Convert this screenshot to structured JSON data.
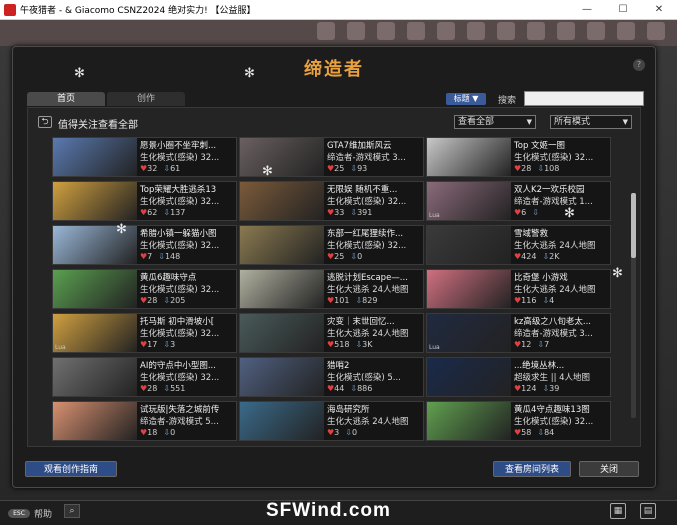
{
  "window": {
    "title": "午夜猎者 - & Giacomo CSNZ2024 绝对实力! 【公益服】",
    "minimize": "—",
    "maximize": "☐",
    "close": "✕"
  },
  "dialog": {
    "title": "缔造者",
    "help": "?",
    "tabs": [
      "首页",
      "创作"
    ],
    "sort_label": "标题",
    "search_label": "搜索",
    "search_value": "",
    "heading": "值得关注查看全部",
    "view_filter": "查看全部",
    "mode_filter": "所有模式",
    "guide_button": "观看创作指南",
    "rooms_button": "查看房间列表",
    "close_button": "关闭"
  },
  "maps": [
    {
      "name": "愿景小圈不坐牢刺...",
      "mode": "生化模式(感染) 32...",
      "likes": "32",
      "downloads": "61",
      "thumb": "#5a7ab0",
      "lua": false
    },
    {
      "name": "GTA7维加斯风云",
      "mode": "缔造者-游戏模式 3...",
      "likes": "25",
      "downloads": "93",
      "thumb": "#6a6060",
      "lua": false
    },
    {
      "name": "Top 文姬一图",
      "mode": "生化模式(感染) 32...",
      "likes": "28",
      "downloads": "108",
      "thumb": "#c8c8c8",
      "lua": false
    },
    {
      "name": "Top荣耀大胜逃杀13",
      "mode": "生化模式(感染) 32...",
      "likes": "62",
      "downloads": "137",
      "thumb": "#d0a040",
      "lua": false
    },
    {
      "name": "无限娱 随机不重...",
      "mode": "生化模式(感染) 32...",
      "likes": "33",
      "downloads": "391",
      "thumb": "#7a5a3a",
      "lua": false
    },
    {
      "name": "双人K2一欢乐校园",
      "mode": "缔造者-游戏模式 1...",
      "likes": "6",
      "downloads": "",
      "thumb": "#8a6a7a",
      "lua": true
    },
    {
      "name": "希腊小镇一躲猫小图",
      "mode": "生化模式(感染) 32...",
      "likes": "7",
      "downloads": "148",
      "thumb": "#9ab8d8",
      "lua": false
    },
    {
      "name": "东部一红尾狸续作...",
      "mode": "生化模式(感染) 32...",
      "likes": "25",
      "downloads": "0",
      "thumb": "#8a7a50",
      "lua": false
    },
    {
      "name": "雪域警救",
      "mode": "生化大逃杀 24人地图",
      "likes": "424",
      "downloads": "2K",
      "thumb": "#3a3a3a",
      "lua": false
    },
    {
      "name": "黄瓜6趣味守点",
      "mode": "生化模式(感染) 32...",
      "likes": "28",
      "downloads": "205",
      "thumb": "#5aa050",
      "lua": false
    },
    {
      "name": "逃脱计划Escape—...",
      "mode": "生化大逃杀 24人地图",
      "likes": "101",
      "downloads": "829",
      "thumb": "#b0b0a0",
      "lua": false
    },
    {
      "name": "比奇堡 小游戏",
      "mode": "生化大逃杀 24人地图",
      "likes": "116",
      "downloads": "4",
      "thumb": "#d07080",
      "lua": false
    },
    {
      "name": "托马斯 初中滑坡小[",
      "mode": "生化模式(感染) 32...",
      "likes": "17",
      "downloads": "3",
      "thumb": "#d0a040",
      "lua": true
    },
    {
      "name": "灾变｜末世回忆...",
      "mode": "生化大逃杀 24人地图",
      "likes": "518",
      "downloads": "3K",
      "thumb": "#4a5a5a",
      "lua": false
    },
    {
      "name": "kz高级之八旬老太...",
      "mode": "缔造者-游戏模式 3...",
      "likes": "12",
      "downloads": "7",
      "thumb": "#202a40",
      "lua": true
    },
    {
      "name": "AI的守点中小型图...",
      "mode": "生化模式(感染) 32...",
      "likes": "28",
      "downloads": "551",
      "thumb": "#707070",
      "lua": false
    },
    {
      "name": "猎哨2",
      "mode": "生化模式(感染) 5...",
      "likes": "44",
      "downloads": "886",
      "thumb": "#506080",
      "lua": false
    },
    {
      "name": "...绝境丛林...",
      "mode": "超级求生 || 4人地图",
      "likes": "124",
      "downloads": "39",
      "thumb": "#1a2a4a",
      "lua": false
    },
    {
      "name": "试玩版|失落之城前传",
      "mode": "缔造者-游戏模式 5...",
      "likes": "18",
      "downloads": "0",
      "thumb": "#d89070",
      "lua": false
    },
    {
      "name": "海岛研究所",
      "mode": "生化大逃杀 24人地图",
      "likes": "3",
      "downloads": "0",
      "thumb": "#3a6a8a",
      "lua": false
    },
    {
      "name": "黄瓜4守点趣味13图",
      "mode": "生化模式(感染) 32...",
      "likes": "58",
      "downloads": "84",
      "thumb": "#60a050",
      "lua": false
    }
  ],
  "icons": {
    "heart": "♥",
    "download": "⇩",
    "back": "⮌",
    "dropdown": "▼"
  },
  "bottombar": {
    "help_toggle": "帮助",
    "help_pill": "ESC",
    "watermark": "SFWind.com"
  }
}
